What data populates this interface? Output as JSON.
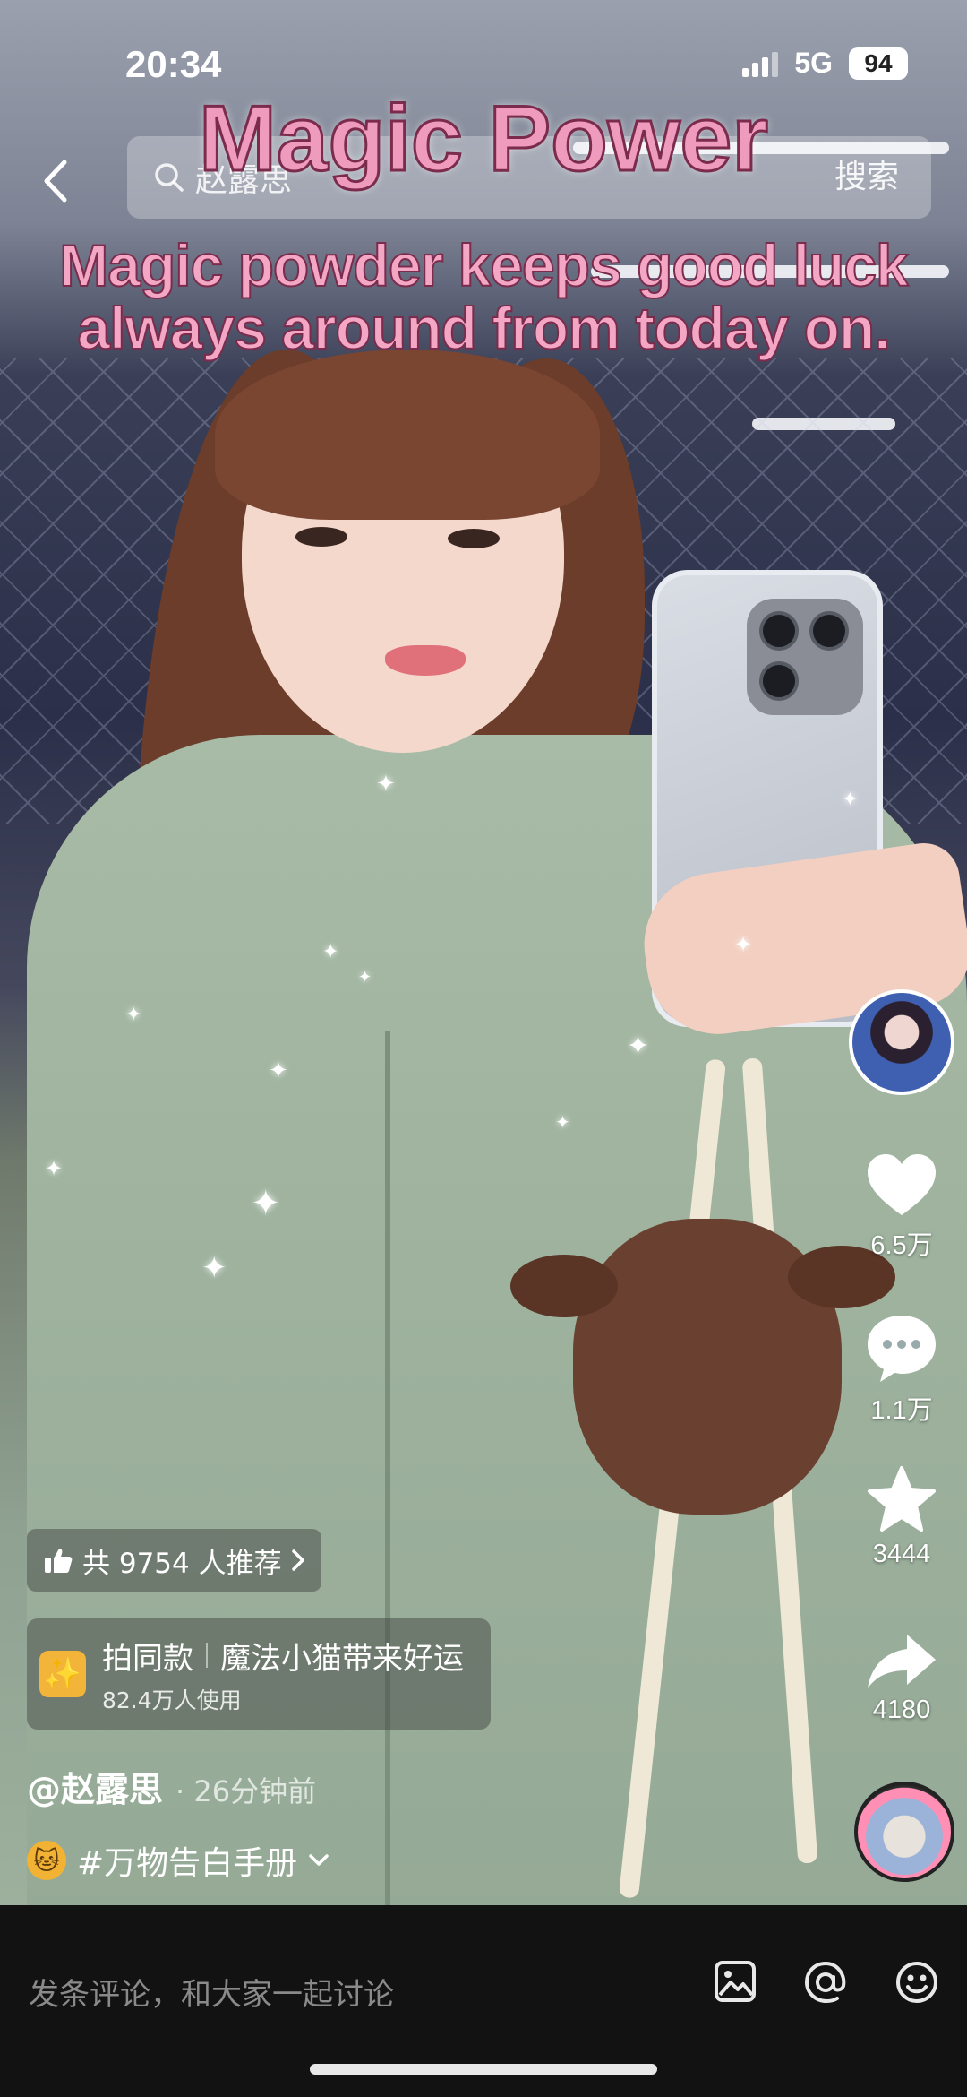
{
  "status_bar": {
    "time": "20:34",
    "network": "5G",
    "battery": "94"
  },
  "search": {
    "query": "赵露思",
    "button_label": "搜索",
    "back_icon": "chevron-left-icon",
    "search_icon": "search-icon"
  },
  "video_overlay": {
    "title": "Magic Power",
    "line1": "Magic powder keeps good luck",
    "line2": "always around from today on."
  },
  "actions": {
    "like_count": "6.5万",
    "comment_count": "1.1万",
    "favorite_count": "3444",
    "share_count": "4180"
  },
  "info": {
    "recommend_text": "共 9754 人推荐",
    "template_name": "拍同款",
    "template_title": "魔法小猫带来好运",
    "template_usage": "82.4万人使用",
    "author": "@赵露思",
    "time_ago": "· 26分钟前",
    "topic": "#万物告白手册"
  },
  "comment_bar": {
    "placeholder": "发条评论，和大家一起讨论"
  },
  "colors": {
    "caption_pink": "#ef9bbd",
    "caption_stroke": "#7b2b4c",
    "comment_bar_bg": "#121212"
  }
}
